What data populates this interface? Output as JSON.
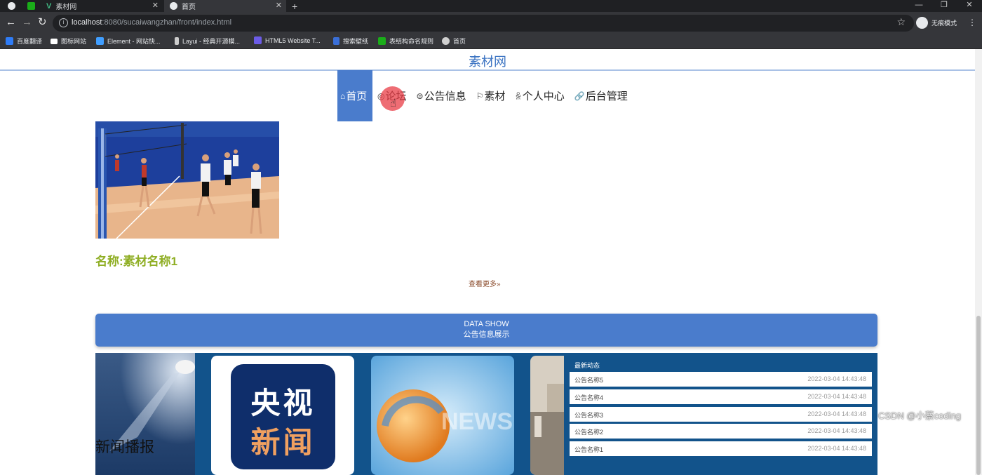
{
  "browser": {
    "tabs": [
      {
        "label": ""
      },
      {
        "label": ""
      },
      {
        "label": "素材网"
      },
      {
        "label": "首页"
      }
    ],
    "new_tab": "+",
    "url_host": "localhost",
    "url_path": ":8080/sucaiwangzhan/front/index.html",
    "profile_label": "无痕模式",
    "bookmarks": [
      {
        "label": "百度翻译",
        "color": "#2f7cf6"
      },
      {
        "label": "图标网站",
        "color": "#ffffff"
      },
      {
        "label": "Element - 网站快...",
        "color": "#409eff"
      },
      {
        "label": "Layui - 经典开源模...",
        "color": "#cccccc"
      },
      {
        "label": "HTML5 Website T...",
        "color": "#6c5ce7"
      },
      {
        "label": "搜索壁纸",
        "color": "#3a6fd8"
      },
      {
        "label": "表结构命名规则",
        "color": "#1aad19"
      },
      {
        "label": "首页",
        "color": "#d0d0d0"
      }
    ]
  },
  "site": {
    "name": "素材网",
    "nav": [
      {
        "label": "首页",
        "icon": "home-icon",
        "active": true
      },
      {
        "label": "论坛",
        "icon": "chat-icon",
        "active": false
      },
      {
        "label": "公告信息",
        "icon": "notice-icon",
        "active": false
      },
      {
        "label": "素材",
        "icon": "flag-icon",
        "active": false
      },
      {
        "label": "个人中心",
        "icon": "user-icon",
        "active": false
      },
      {
        "label": "后台管理",
        "icon": "link-icon",
        "active": false
      }
    ]
  },
  "material": {
    "name": "名称:素材名称1",
    "more": "查看更多"
  },
  "datashow": {
    "line1": "DATA SHOW",
    "line2": "公告信息展示"
  },
  "news": {
    "card1_title": "新闻播报",
    "cctv_line1": "央视",
    "cctv_line2": "新闻",
    "card3_text": "NEWS",
    "latest_title": "最新动态",
    "items": [
      {
        "name": "公告名称5",
        "time": "2022-03-04 14:43:48"
      },
      {
        "name": "公告名称4",
        "time": "2022-03-04 14:43:48"
      },
      {
        "name": "公告名称3",
        "time": "2022-03-04 14:43:48"
      },
      {
        "name": "公告名称2",
        "time": "2022-03-04 14:43:48"
      },
      {
        "name": "公告名称1",
        "time": "2022-03-04 14:43:48"
      }
    ]
  },
  "watermark": "CSDN @小蔡coding"
}
